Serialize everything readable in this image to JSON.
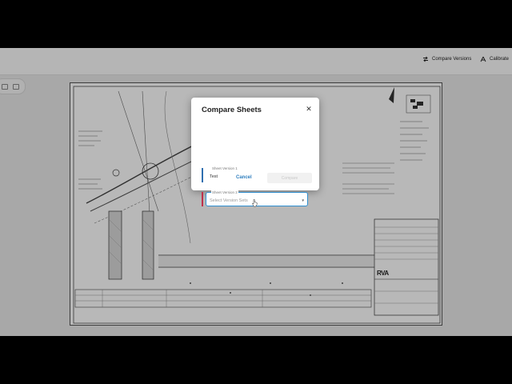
{
  "toolbar": {
    "compare_versions_label": "Compare Versions",
    "calibrate_label": "Calibrate"
  },
  "dialog": {
    "title": "Compare Sheets",
    "field1": {
      "label": "Sheet Version 1",
      "value": "Test",
      "accent": "#2f6fb0"
    },
    "field2": {
      "label": "Sheet Version 2",
      "placeholder": "Select Version Sets",
      "accent": "#c0304a"
    },
    "cancel_label": "Cancel",
    "compare_label": "Compare"
  },
  "sheet": {
    "company": "RVA"
  }
}
